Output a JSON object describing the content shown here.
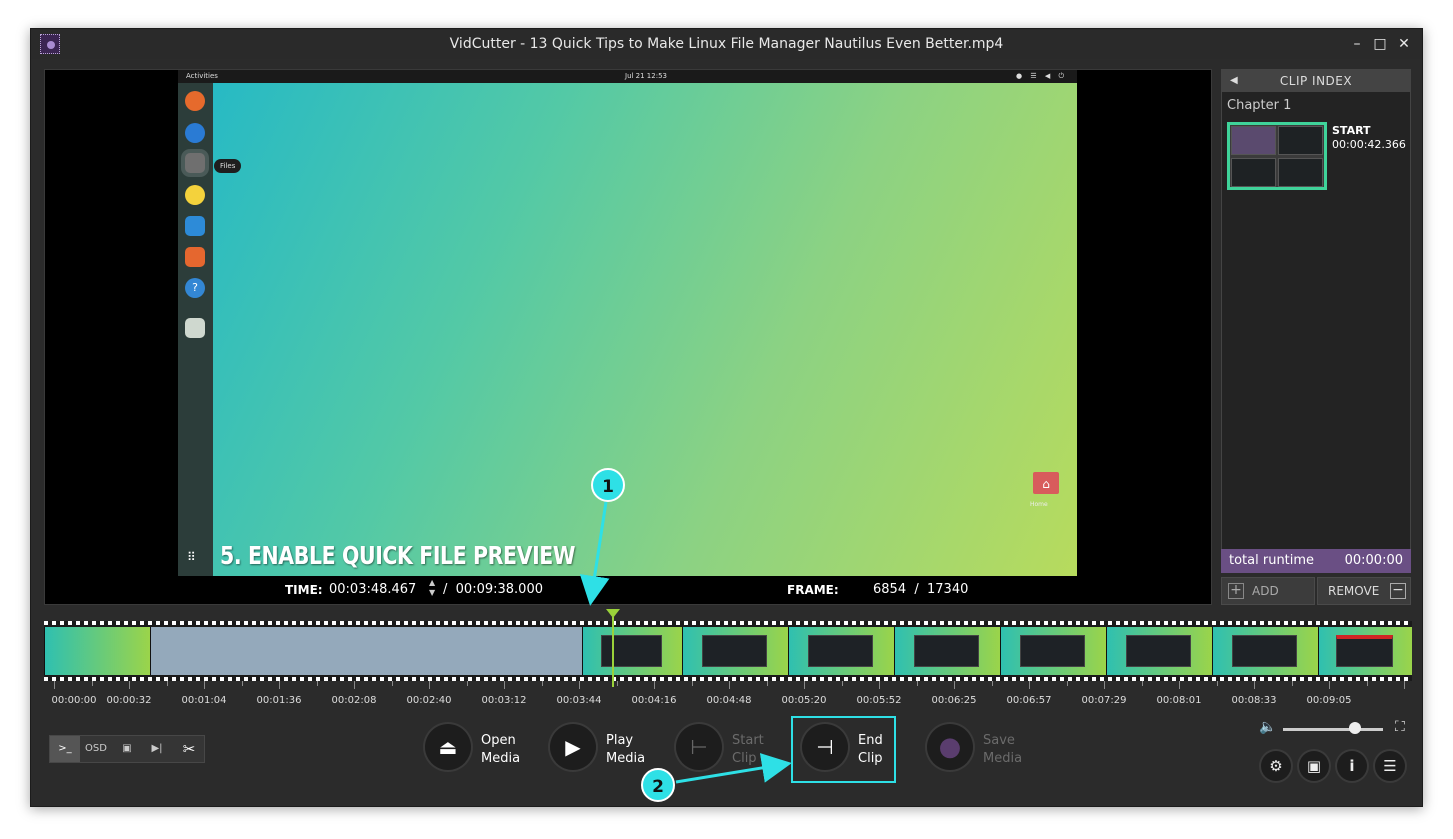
{
  "window": {
    "title": "VidCutter - 13 Quick Tips to Make Linux File Manager Nautilus Even Better.mp4",
    "minimize": "–",
    "maximize": "□",
    "close": "✕"
  },
  "video": {
    "screen_topbar_left": "Activities",
    "screen_clock": "Jul 21  12:53",
    "screen_tray": "● ☰ ◀ ⏻",
    "dock_tooltip": "Files",
    "overlay_text": "5. ENABLE QUICK FILE PREVIEW",
    "desktop_home_label": "Home",
    "dock_icons": [
      "firefox-icon",
      "thunderbird-icon",
      "files-icon",
      "rhythmbox-icon",
      "writer-icon",
      "software-icon",
      "help-icon",
      "trash-icon"
    ]
  },
  "timebar": {
    "time_label": "TIME:",
    "current_time": "00:03:48.467",
    "separator": "/",
    "total_time": "00:09:38.000",
    "frame_label": "FRAME:",
    "current_frame": "6854",
    "frame_separator": "/",
    "total_frames": "17340"
  },
  "clip_index": {
    "title": "CLIP INDEX",
    "chapter": "Chapter 1",
    "clips": [
      {
        "label": "START",
        "time": "00:00:42.366"
      }
    ],
    "runtime_label": "total runtime",
    "runtime_value": "00:00:00",
    "add_label": "ADD",
    "remove_label": "REMOVE"
  },
  "timeline": {
    "tick_labels": [
      "00:00:00",
      "00:00:32",
      "00:01:04",
      "00:01:36",
      "00:02:08",
      "00:02:40",
      "00:03:12",
      "00:03:44",
      "00:04:16",
      "00:04:48",
      "00:05:20",
      "00:05:52",
      "00:06:25",
      "00:06:57",
      "00:07:29",
      "00:08:01",
      "00:08:33",
      "00:09:05"
    ],
    "playhead_position_fraction": 0.395
  },
  "toolbar": {
    "console_label": ">_",
    "osd_label": "OSD",
    "chapters_label": "▣",
    "skip_label": "▶|",
    "scissors_label": "✂"
  },
  "controls": {
    "open_label_1": "Open",
    "open_label_2": "Media",
    "play_label_1": "Play",
    "play_label_2": "Media",
    "start_label_1": "Start",
    "start_label_2": "Clip",
    "end_label_1": "End",
    "end_label_2": "Clip",
    "save_label_1": "Save",
    "save_label_2": "Media"
  },
  "volume": {
    "level": 0.72
  },
  "annotations": {
    "badge_1": "1",
    "badge_2": "2"
  },
  "colors": {
    "accent_green": "#3fd39a",
    "playhead": "#9ad23a",
    "runtime_bg": "#6a4f84",
    "annotation": "#2ee0e6"
  }
}
